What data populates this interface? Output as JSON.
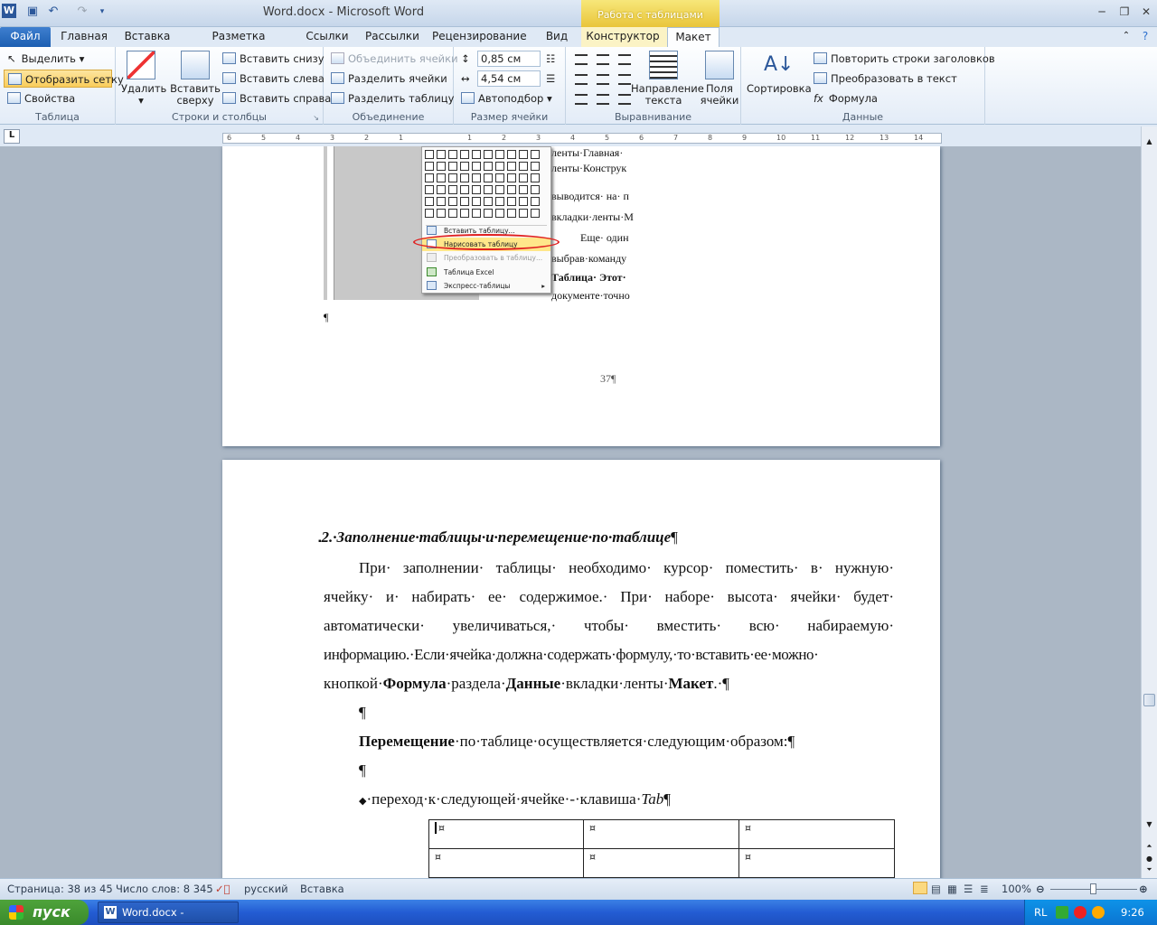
{
  "window": {
    "title": "Word.docx  -  Microsoft Word",
    "context_group": "Работа с таблицами",
    "app_letter": "W"
  },
  "tabs": [
    "Файл",
    "Главная",
    "Вставка",
    "Разметка страницы",
    "Ссылки",
    "Рассылки",
    "Рецензирование",
    "Вид",
    "Конструктор",
    "Макет"
  ],
  "ribbon": {
    "table_group": {
      "label": "Таблица",
      "select": "Выделить",
      "show_grid": "Отобразить сетку",
      "properties": "Свойства"
    },
    "rows_cols": {
      "label": "Строки и столбцы",
      "delete": "Удалить",
      "insert_above_1": "Вставить",
      "insert_above_2": "сверху",
      "insert_below": "Вставить снизу",
      "insert_left": "Вставить слева",
      "insert_right": "Вставить справа"
    },
    "merge": {
      "label": "Объединение",
      "merge_cells": "Объединить ячейки",
      "split_cells": "Разделить ячейки",
      "split_table": "Разделить таблицу"
    },
    "cell_size": {
      "label": "Размер ячейки",
      "height": "0,85 см",
      "width": "4,54 см",
      "autofit": "Автоподбор"
    },
    "alignment": {
      "label": "Выравнивание",
      "text_dir_1": "Направление",
      "text_dir_2": "текста",
      "margins_1": "Поля",
      "margins_2": "ячейки"
    },
    "data": {
      "label": "Данные",
      "sort": "Сортировка",
      "repeat_header": "Повторить строки заголовков",
      "to_text": "Преобразовать в текст",
      "formula": "Формула"
    }
  },
  "ruler_numbers": [
    "6",
    "5",
    "4",
    "3",
    "2",
    "1",
    "",
    "1",
    "2",
    "3",
    "4",
    "5",
    "6",
    "7",
    "8",
    "9",
    "10",
    "11",
    "12",
    "13",
    "14"
  ],
  "page1": {
    "lines": [
      "ленты·Главная·",
      "ленты·Конструк",
      "выводится· на· п",
      "вкладки·ленты·М",
      "Еще· один",
      "выбрав·команду",
      "Таблица· Этот·",
      "документе·точно"
    ],
    "pilcrow": "¶",
    "page_number": "37¶"
  },
  "menu": {
    "items": [
      "Вставить таблицу...",
      "Нарисовать таблицу",
      "Преобразовать в таблицу...",
      "Таблица Excel",
      "Экспресс-таблицы"
    ]
  },
  "page2": {
    "heading": "2.·Заполнение·таблицы·и·перемещение·по·таблице",
    "heading_mark": "¶",
    "p1": [
      "При· заполнении· таблицы· необходимо· курсор· поместить· в· нужную·",
      "ячейку· и· набирать· ее· содержимое.· При· наборе· высота· ячейки· будет·",
      "автоматически·    увеличиваться,·    чтобы·    вместить·    всю·    набираемую·",
      "информацию.·Если·ячейка·должна·содержать·формулу,·то·вставить·ее·можно·"
    ],
    "p1_last_a": "кнопкой·",
    "p1_last_b": "Формула",
    "p1_last_c": "·раздела·",
    "p1_last_d": "Данные",
    "p1_last_e": "·вкладки·ленты·",
    "p1_last_f": "Макет",
    "p1_last_g": ".·¶",
    "empty": "¶",
    "move_bold": "Перемещение",
    "move_rest": "·по·таблице·осуществляется·следующим·образом:¶",
    "bullet": "·переход·к·следующей·ячейке·-·клавиша·",
    "bullet_key": "Tab",
    "bullet_end": "¶",
    "cell_mark": "¤"
  },
  "status": {
    "page": "Страница: 38 из 45",
    "words": "Число слов: 8 345",
    "lang": "русский",
    "mode": "Вставка",
    "zoom": "100%"
  },
  "taskbar": {
    "start": "пуск",
    "task": "Word.docx - Microsof...",
    "lang": "RL",
    "time": "9:26"
  }
}
